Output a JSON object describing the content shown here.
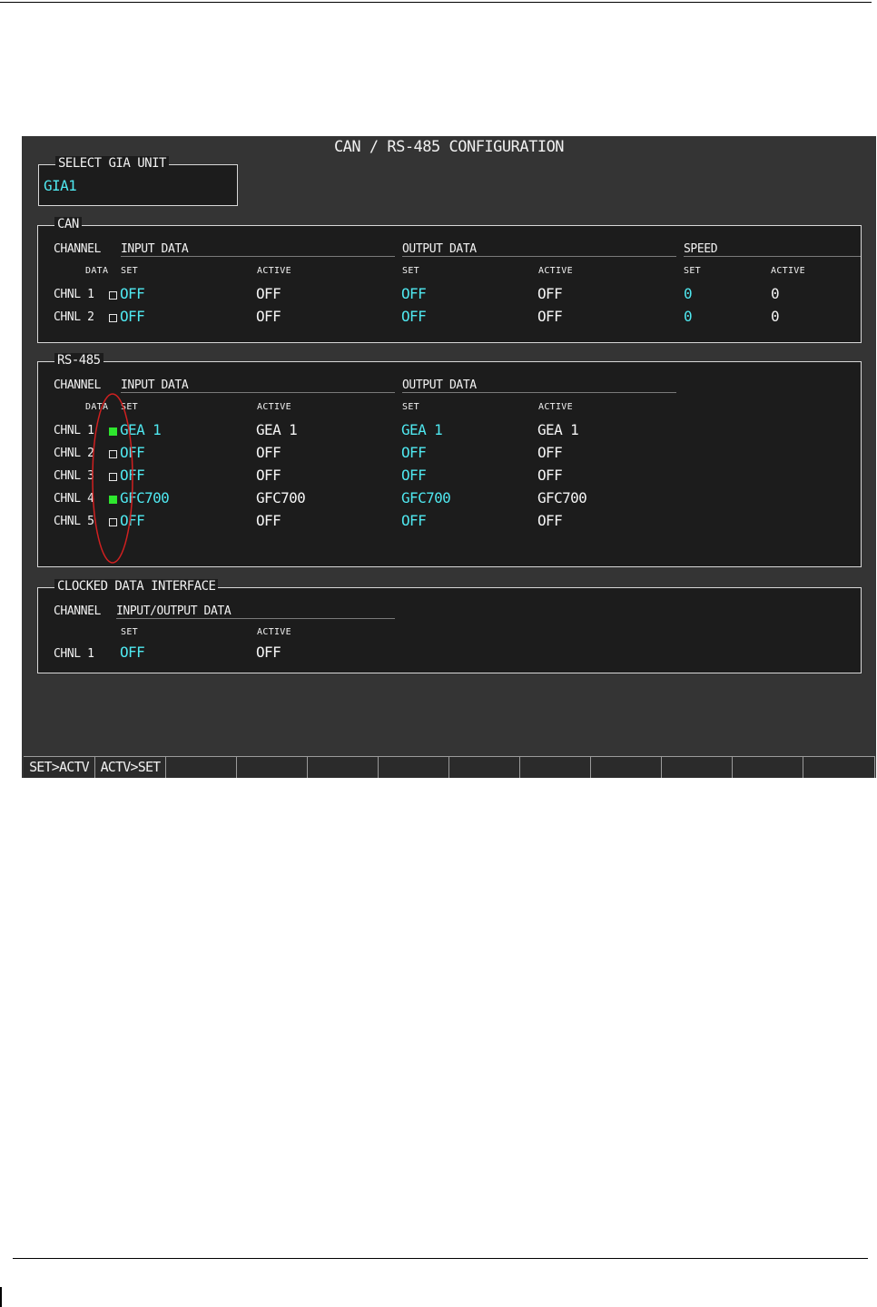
{
  "title": "CAN / RS-485 CONFIGURATION",
  "gia_unit": {
    "label": "SELECT GIA UNIT",
    "value": "GIA1"
  },
  "can": {
    "label": "CAN",
    "channel_header": "CHANNEL",
    "input_header": "INPUT DATA",
    "output_header": "OUTPUT DATA",
    "speed_header": "SPEED",
    "data_sub": "DATA",
    "set_sub": "SET",
    "active_sub": "ACTIVE",
    "rows": [
      {
        "channel": "CHNL 1",
        "checked": false,
        "input_set": "OFF",
        "input_active": "OFF",
        "output_set": "OFF",
        "output_active": "OFF",
        "speed_set": "0",
        "speed_active": "0"
      },
      {
        "channel": "CHNL 2",
        "checked": false,
        "input_set": "OFF",
        "input_active": "OFF",
        "output_set": "OFF",
        "output_active": "OFF",
        "speed_set": "0",
        "speed_active": "0"
      }
    ]
  },
  "rs485": {
    "label": "RS-485",
    "channel_header": "CHANNEL",
    "input_header": "INPUT DATA",
    "output_header": "OUTPUT DATA",
    "data_sub": "DATA",
    "set_sub": "SET",
    "active_sub": "ACTIVE",
    "rows": [
      {
        "channel": "CHNL 1",
        "checked": true,
        "input_set": "GEA 1",
        "input_active": "GEA 1",
        "output_set": "GEA 1",
        "output_active": "GEA 1"
      },
      {
        "channel": "CHNL 2",
        "checked": false,
        "input_set": "OFF",
        "input_active": "OFF",
        "output_set": "OFF",
        "output_active": "OFF"
      },
      {
        "channel": "CHNL 3",
        "checked": false,
        "input_set": "OFF",
        "input_active": "OFF",
        "output_set": "OFF",
        "output_active": "OFF"
      },
      {
        "channel": "CHNL 4",
        "checked": true,
        "input_set": "GFC700",
        "input_active": "GFC700",
        "output_set": "GFC700",
        "output_active": "GFC700"
      },
      {
        "channel": "CHNL 5",
        "checked": false,
        "input_set": "OFF",
        "input_active": "OFF",
        "output_set": "OFF",
        "output_active": "OFF"
      }
    ]
  },
  "clocked": {
    "label": "CLOCKED DATA INTERFACE",
    "channel_header": "CHANNEL",
    "io_header": "INPUT/OUTPUT DATA",
    "set_sub": "SET",
    "active_sub": "ACTIVE",
    "rows": [
      {
        "channel": "CHNL 1",
        "set": "OFF",
        "active": "OFF"
      }
    ]
  },
  "softkeys": [
    "SET>ACTV",
    "ACTV>SET",
    "",
    "",
    "",
    "",
    "",
    "",
    "",
    "",
    "",
    ""
  ],
  "colors": {
    "screen_bg": "#343434",
    "panel_bg": "#1c1c1c",
    "set_value": "#4fe8f0",
    "checked": "#2ee62e",
    "annotation": "#d02020"
  }
}
